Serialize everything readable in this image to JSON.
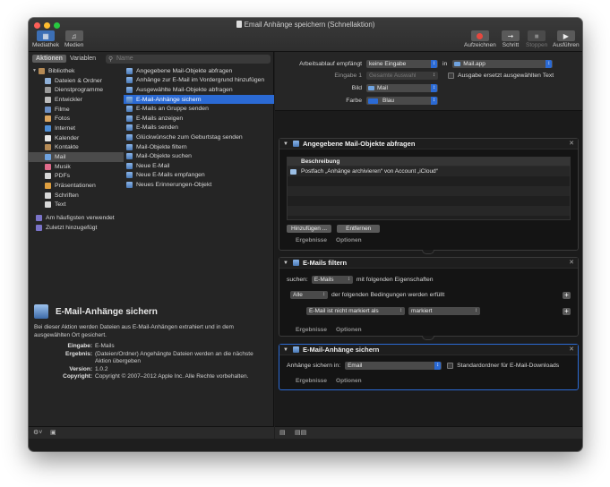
{
  "window": {
    "title": "Email Anhänge speichern (Schnellaktion)"
  },
  "toolbar": {
    "left": [
      {
        "label": "Mediathek",
        "icon": "library-icon"
      },
      {
        "label": "Medien",
        "icon": "media-icon"
      }
    ],
    "right": [
      {
        "label": "Aufzeichnen",
        "icon": "record-icon"
      },
      {
        "label": "Schritt",
        "icon": "step-icon"
      },
      {
        "label": "Stoppen",
        "icon": "stop-icon",
        "disabled": true
      },
      {
        "label": "Ausführen",
        "icon": "run-icon"
      }
    ]
  },
  "library": {
    "tabs": [
      "Aktionen",
      "Variablen"
    ],
    "search_placeholder": "Name",
    "categories": [
      {
        "label": "Bibliothek",
        "root": true,
        "color": "#b58a55"
      },
      {
        "label": "Dateien & Ordner",
        "color": "#8fb0d8"
      },
      {
        "label": "Dienstprogramme",
        "color": "#9a9a9a"
      },
      {
        "label": "Entwickler",
        "color": "#bcbcbc"
      },
      {
        "label": "Filme",
        "color": "#6c8fc4"
      },
      {
        "label": "Fotos",
        "color": "#dca660"
      },
      {
        "label": "Internet",
        "color": "#4e8fd8"
      },
      {
        "label": "Kalender",
        "color": "#e8e8e8"
      },
      {
        "label": "Kontakte",
        "color": "#b58a55"
      },
      {
        "label": "Mail",
        "color": "#6fa3e0",
        "selected": true
      },
      {
        "label": "Musik",
        "color": "#e06a8a"
      },
      {
        "label": "PDFs",
        "color": "#d8d8d8"
      },
      {
        "label": "Präsentationen",
        "color": "#e0a040"
      },
      {
        "label": "Schriften",
        "color": "#d8d8d8"
      },
      {
        "label": "Text",
        "color": "#d8d8d8"
      }
    ],
    "extras": [
      {
        "label": "Am häufigsten verwendet",
        "color": "#7a73c8"
      },
      {
        "label": "Zuletzt hinzugefügt",
        "color": "#7a73c8"
      }
    ],
    "actions": [
      "Angegebene Mail-Objekte abfragen",
      "Anhänge zur E-Mail im Vordergrund hinzufügen",
      "Ausgewählte Mail-Objekte abfragen",
      "E-Mail-Anhänge sichern",
      "E-Mails an Gruppe senden",
      "E-Mails anzeigen",
      "E-Mails senden",
      "Glückwünsche zum Geburtstag senden",
      "Mail-Objekte filtern",
      "Mail-Objekte suchen",
      "Neue E-Mail",
      "Neue E-Mails empfangen",
      "Neues Erinnerungen-Objekt"
    ],
    "selected_action": 3
  },
  "description": {
    "title": "E-Mail-Anhänge sichern",
    "text": "Bei dieser Aktion werden Dateien aus E-Mail-Anhängen extrahiert und in dem ausgewählten Ort gesichert.",
    "fields": [
      {
        "key": "Eingabe:",
        "value": "E-Mails"
      },
      {
        "key": "Ergebnis:",
        "value": "(Dateien/Ordner) Angehängte Dateien werden an die nächste Aktion übergeben"
      },
      {
        "key": "Version:",
        "value": "1.0.2"
      },
      {
        "key": "Copyright:",
        "value": "Copyright © 2007–2012 Apple Inc. Alle Rechte vorbehalten."
      }
    ]
  },
  "workflow": {
    "receives_label": "Arbeitsablauf empfängt",
    "receives_value": "keine Eingabe",
    "in_label": "in",
    "app_value": "Mail.app",
    "input_label": "Eingabe 1",
    "input_value": "Gesamte Auswahl",
    "replace_label": "Ausgabe ersetzt ausgewählten Text",
    "image_label": "Bild",
    "image_value": "Mail",
    "color_label": "Farbe",
    "color_value": "Blau",
    "color_hex": "#2b6ad4"
  },
  "cards": {
    "query": {
      "title": "Angegebene Mail-Objekte abfragen",
      "column": "Beschreibung",
      "rows": [
        "Postfach „Anhänge archivieren“ von Account „iCloud“"
      ],
      "add_label": "Hinzufügen ...",
      "remove_label": "Entfernen",
      "results": "Ergebnisse",
      "options": "Optionen"
    },
    "filter": {
      "title": "E-Mails filtern",
      "search_label": "suchen:",
      "search_value": "E-Mails",
      "props_label": "mit folgenden Eigenschaften",
      "match_value": "Alle",
      "match_label": "der folgenden Bedingungen werden erfüllt",
      "cond_field": "E-Mail ist nicht markiert als",
      "cond_value": "markiert",
      "results": "Ergebnisse",
      "options": "Optionen"
    },
    "save": {
      "title": "E-Mail-Anhänge sichern",
      "save_label": "Anhänge sichern in:",
      "save_value": "Email",
      "default_label": "Standardordner für E-Mail-Downloads",
      "results": "Ergebnisse",
      "options": "Optionen"
    }
  }
}
